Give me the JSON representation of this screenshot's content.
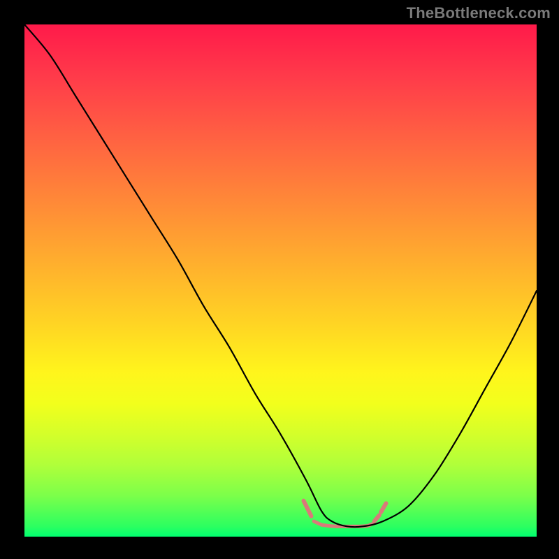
{
  "watermark": "TheBottleneck.com",
  "colors": {
    "frame": "#000000",
    "gradient_top": "#ff1a4a",
    "gradient_bottom": "#00ff70",
    "curve": "#000000",
    "marker": "#d97a7a"
  },
  "chart_data": {
    "type": "line",
    "title": "",
    "xlabel": "",
    "ylabel": "",
    "xlim": [
      0,
      100
    ],
    "ylim": [
      0,
      100
    ],
    "grid": false,
    "series": [
      {
        "name": "bottleneck-curve",
        "x": [
          0,
          5,
          10,
          15,
          20,
          25,
          30,
          35,
          40,
          45,
          50,
          55,
          58,
          60,
          63,
          66,
          70,
          75,
          80,
          85,
          90,
          95,
          100
        ],
        "y": [
          100,
          94,
          86,
          78,
          70,
          62,
          54,
          45,
          37,
          28,
          20,
          11,
          5,
          3,
          2,
          2,
          3,
          6,
          12,
          20,
          29,
          38,
          48
        ]
      }
    ],
    "flat_region": {
      "x_start": 55,
      "x_end": 70,
      "y": 2
    },
    "flat_markers": {
      "color": "#d97a7a",
      "segments": [
        {
          "x0": 54.5,
          "y0": 7.0,
          "x1": 56.0,
          "y1": 4.0,
          "w": 6
        },
        {
          "x0": 56.5,
          "y0": 3.0,
          "x1": 58.0,
          "y1": 2.3,
          "w": 5
        },
        {
          "x0": 58.0,
          "y0": 2.3,
          "x1": 59.5,
          "y1": 2.1,
          "w": 5
        },
        {
          "x0": 59.5,
          "y0": 2.1,
          "x1": 61.0,
          "y1": 2.0,
          "w": 5
        },
        {
          "x0": 61.0,
          "y0": 2.0,
          "x1": 62.5,
          "y1": 2.0,
          "w": 5
        },
        {
          "x0": 62.5,
          "y0": 2.0,
          "x1": 64.0,
          "y1": 2.0,
          "w": 5
        },
        {
          "x0": 64.0,
          "y0": 2.0,
          "x1": 65.5,
          "y1": 2.0,
          "w": 5
        },
        {
          "x0": 65.5,
          "y0": 2.0,
          "x1": 67.0,
          "y1": 2.1,
          "w": 5
        },
        {
          "x0": 67.0,
          "y0": 2.1,
          "x1": 68.0,
          "y1": 2.5,
          "w": 5
        },
        {
          "x0": 68.3,
          "y0": 3.0,
          "x1": 69.3,
          "y1": 4.2,
          "w": 6
        },
        {
          "x0": 69.6,
          "y0": 4.8,
          "x1": 70.6,
          "y1": 6.5,
          "w": 6
        }
      ]
    }
  }
}
